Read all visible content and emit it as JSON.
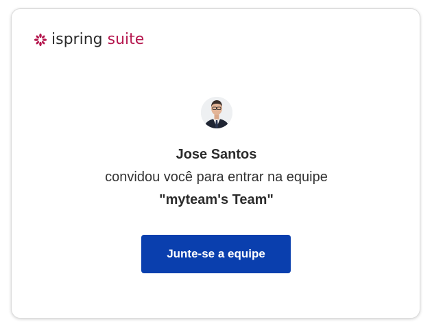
{
  "brand": {
    "logo_word": "ispring",
    "logo_product": "suite",
    "logo_icon": "ispring-flower-icon",
    "accent_color": "#b5174e"
  },
  "invitation": {
    "inviter_name": "Jose Santos",
    "message": "convidou você para entrar na equipe",
    "team_name": "\"myteam's Team\""
  },
  "actions": {
    "join_label": "Junte-se a equipe",
    "join_color": "#0a3fae"
  }
}
